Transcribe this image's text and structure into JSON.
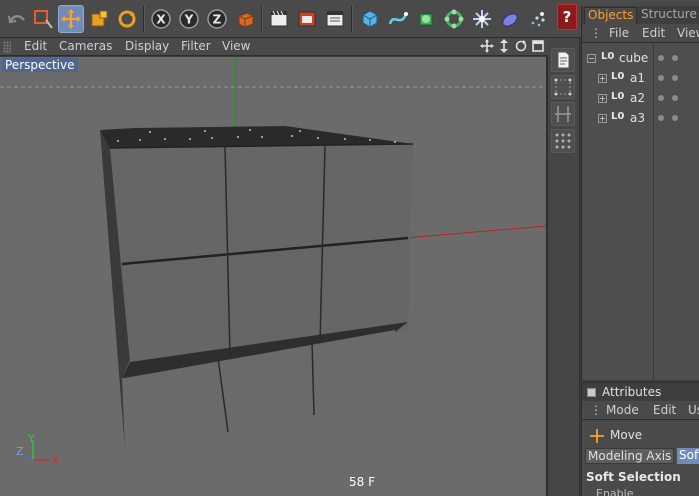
{
  "viewport": {
    "menu": [
      "Edit",
      "Cameras",
      "Display",
      "Filter",
      "View"
    ],
    "camera_label": "Perspective",
    "frame_label": "58 F",
    "axis_labels": [
      "Y",
      "Z",
      "X"
    ]
  },
  "objects_panel": {
    "tabs": [
      "Objects",
      "Structure"
    ],
    "active_tab": "Objects",
    "menu": [
      "File",
      "Edit",
      "View"
    ],
    "items": [
      {
        "name": "cube",
        "depth": 0
      },
      {
        "name": "a1",
        "depth": 1
      },
      {
        "name": "a2",
        "depth": 1
      },
      {
        "name": "a3",
        "depth": 1
      }
    ]
  },
  "attributes_panel": {
    "title": "Attributes",
    "menu": [
      "Mode",
      "Edit",
      "User"
    ],
    "tool": "Move",
    "tabs": [
      "Modeling Axis",
      "Soft"
    ],
    "active_tab": "Soft",
    "section": "Soft Selection",
    "field_label": "Enable"
  },
  "toolbar": {
    "tools": [
      "undo-icon",
      "live-selection-icon",
      "move-icon",
      "scale-icon",
      "rotate-icon",
      "x-axis-lock-icon",
      "y-axis-lock-icon",
      "z-axis-lock-icon",
      "world-coordinate-icon",
      "render-view-icon",
      "render-picture-viewer-icon",
      "render-settings-icon",
      "cube-primitive-icon",
      "spline-icon",
      "nurbs-icon",
      "array-icon",
      "deformer-icon",
      "scene-icon",
      "light-icon"
    ],
    "selected": "move-icon",
    "help_label": "?"
  },
  "colors": {
    "accent": "#ffa028",
    "selection": "#6f8db8",
    "viewport_bg": "#6b6b6b"
  }
}
